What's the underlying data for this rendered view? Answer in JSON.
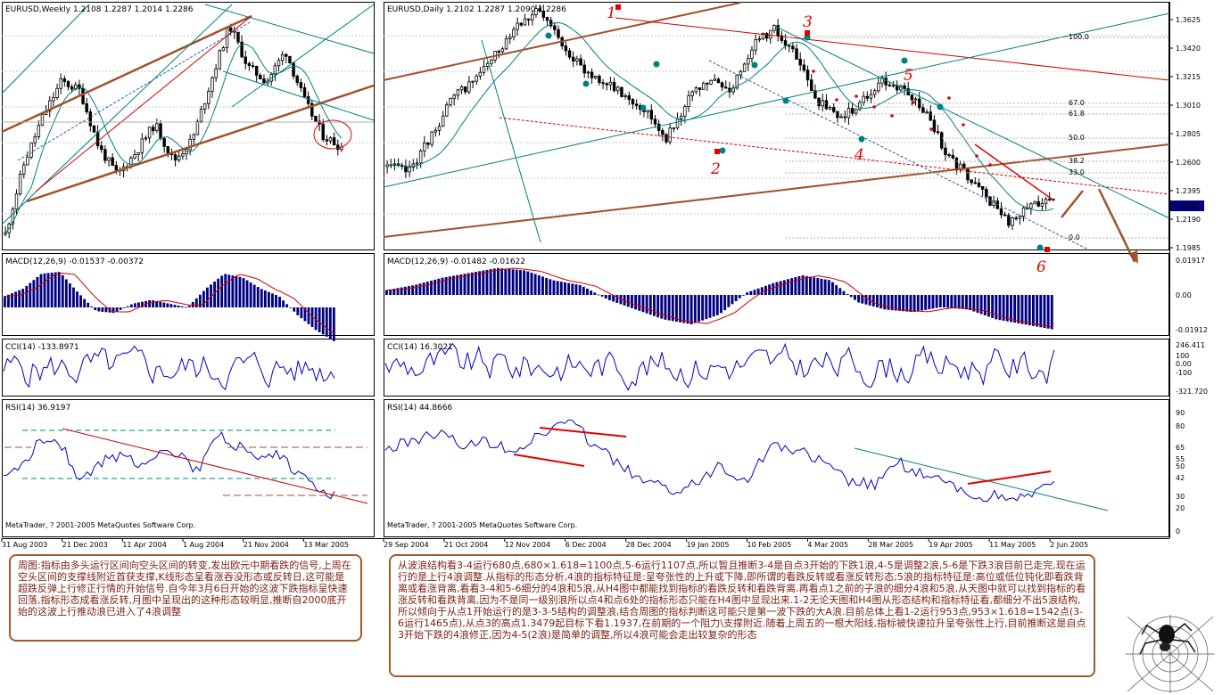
{
  "weekly": {
    "title": "EURUSD,Weekly  1.2108 1.2287 1.2014 1.2286",
    "macd_title": "MACD(12,26,9) -0.01537 -0.00372",
    "cci_title": "CCI(14) -133.8971",
    "rsi_title": "RSI(14) 36.9197",
    "copyright": "MetaTrader, ? 2001-2005 MetaQuotes Software Corp.",
    "dates": [
      "31 Aug 2003",
      "21 Dec 2003",
      "11 Apr 2004",
      "1 Aug 2004",
      "21 Nov 2004",
      "13 Mar 2005"
    ]
  },
  "daily": {
    "title": "EURUSD,Daily  1.2102 1.2287 1.2090 1.2286",
    "macd_title": "MACD(12,26,9) -0.01482 -0.01622",
    "cci_title": "CCI(14) 16.3021",
    "rsi_title": "RSI(14) 44.8666",
    "copyright": "MetaTrader, ? 2001-2005 MetaQuotes Software Corp.",
    "dates": [
      "29 Sep 2004",
      "21 Oct 2004",
      "12 Nov 2004",
      "6 Dec 2004",
      "28 Dec 2004",
      "19 Jan 2005",
      "10 Feb 2005",
      "4 Mar 2005",
      "28 Mar 2005",
      "19 Apr 2005",
      "11 May 2005",
      "2 Jun 2005"
    ],
    "price_ticks": [
      "1.3625",
      "1.3420",
      "1.3215",
      "1.3010",
      "1.2805",
      "1.2600",
      "1.2395",
      "1.2190",
      "1.1985"
    ],
    "current_price": "1.2286",
    "fib_levels": [
      "100.0",
      "67.0",
      "61.8",
      "50.0",
      "38.2",
      "33.0",
      "0.0"
    ],
    "wave_labels": [
      "1",
      "2",
      "3",
      "4",
      "5",
      "6"
    ],
    "macd_ticks": [
      "0.01917",
      "0.00",
      "-0.01912"
    ],
    "cci_ticks": [
      "246.411",
      "100",
      "0.00",
      "-100",
      "-321.720"
    ],
    "rsi_ticks": [
      "90",
      "80",
      "65",
      "55",
      "50",
      "42",
      "30",
      "20",
      "0"
    ]
  },
  "chart_data": [
    {
      "type": "candlestick",
      "title": "EURUSD,Weekly  1.2108 1.2287 1.2014 1.2286",
      "timeframe": "Weekly",
      "open": 1.2108,
      "high": 1.2287,
      "low": 1.2014,
      "close": 1.2286,
      "x_range": [
        "31 Aug 2003",
        "13 Mar 2005"
      ],
      "indicators": {
        "macd": [
          -0.01537,
          -0.00372
        ],
        "cci": -133.8971,
        "rsi": 36.9197
      }
    },
    {
      "type": "candlestick",
      "title": "EURUSD,Daily  1.2102 1.2287 1.2090 1.2286",
      "timeframe": "Daily",
      "open": 1.2102,
      "high": 1.2287,
      "low": 1.209,
      "close": 1.2286,
      "ylim": [
        1.1985,
        1.3625
      ],
      "pivots": [
        {
          "label": "1",
          "date": "28 Dec 2004",
          "price": 1.3667
        },
        {
          "label": "2",
          "date": "19 Jan 2005",
          "price": 1.2866
        },
        {
          "label": "3",
          "date": "4 Mar 2005",
          "price": 1.3479
        },
        {
          "label": "4",
          "date": "28 Mar 2005",
          "price": 1.2799
        },
        {
          "label": "5",
          "date": "19 Apr 2005",
          "price": 1.3128
        },
        {
          "label": "6",
          "date": "2 Jun 2005",
          "price": 1.203
        }
      ],
      "fibonacci": [
        {
          "level": "100.0",
          "price": 1.3479
        },
        {
          "level": "67.0",
          "price": 1.304
        },
        {
          "level": "61.8",
          "price": 1.2972
        },
        {
          "level": "50.0",
          "price": 1.2815
        },
        {
          "level": "38.2",
          "price": 1.2658
        },
        {
          "level": "33.0",
          "price": 1.2589
        },
        {
          "level": "0.0",
          "price": 1.215
        }
      ],
      "indicators": {
        "macd": [
          -0.01482,
          -0.01622
        ],
        "cci": 16.3021,
        "rsi": 44.8666
      }
    }
  ],
  "notes": {
    "left": "周图:指标由多头运行区间向空头区间的转变,发出欧元中期看跌的信号,上周在空头区间的支撑线附近首获支撑,K线形态呈看涨吞没形态或反转日,这可能是超跌反弹上行修正行情的开始信号.自今年3月6日开始的这波下跌指标呈快速回落,指标形态成看涨反转,月图中呈现出的这种形态较明显,推断自2000底开始的这波上行推动浪已进入了4浪调整",
    "right": "从波浪结构看3-4运行680点,680×1.618=1100点,5-6运行1107点,所以暂且推断3-4是自点3开始的下跌1浪,4-5是调整2浪,5-6是下跌3浪目前已走完,现在运行的是上行4浪调整.从指标的形态分析,4浪的指标特征是:呈夸张性的上升或下降,即所谓的看跌反转或看涨反转形态;5浪的指标特征是:高位或低位钝化即看跌背离或看涨背离,看看3-4和5-6细分的4浪和5浪,从H4图中都能找到指标的看跌反转和看跌背离.再看点1之前的子浪的细分4浪和5浪,从天图中就可以找到指标的看涨反转和看跌背离,因为不是同一级别浪所以点4和点6处的指标形态只能在H4图中显现出来.1-2无论天图和H4图从形态结构和指标特征看,都细分不出5浪结构,所以倾向于从点1开始运行的是3-3-5结构的调整浪,结合周图的指标判断这可能只是第一波下跌的大A浪.目前总体上看1-2运行953点,953×1.618=1542点(3-6运行1465点),从点3的高点1.3479起目标下看1.1937,在前期的一个阻力\\支撑附近.随着上周五的一根大阳线,指标被快速拉升呈夸张性上行,目前推断这是自点3开始下跌的4浪修正,因为4-5(2浪)是简单的调整,所以4浪可能会走出较复杂的形态"
  }
}
